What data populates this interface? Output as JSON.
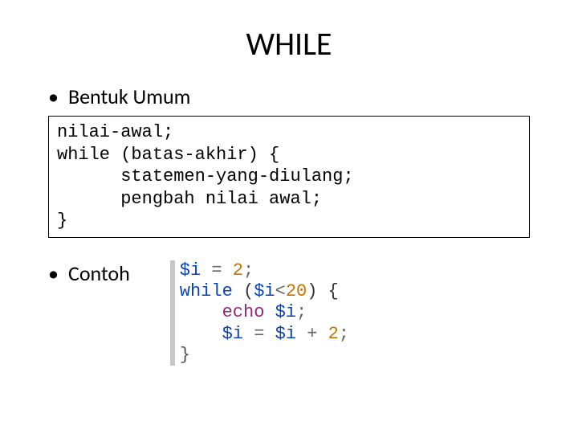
{
  "title": "WHILE",
  "bullets": {
    "umum": "Bentuk Umum",
    "contoh": "Contoh"
  },
  "syntax": {
    "line1": "nilai-awal;",
    "line2": "while (batas-akhir) {",
    "line3": "      statemen-yang-diulang;",
    "line4": "      pengbah nilai awal;",
    "line5": "}"
  },
  "php": {
    "var": "$i",
    "assign": " = ",
    "two": "2",
    "semi": ";",
    "while": "while",
    "sp": " ",
    "lparen": "(",
    "rparen": ")",
    "lt": "<",
    "twenty": "20",
    "lbrace": " {",
    "rbrace": "}",
    "indent": "    ",
    "echo": "echo",
    "plus": " + "
  }
}
